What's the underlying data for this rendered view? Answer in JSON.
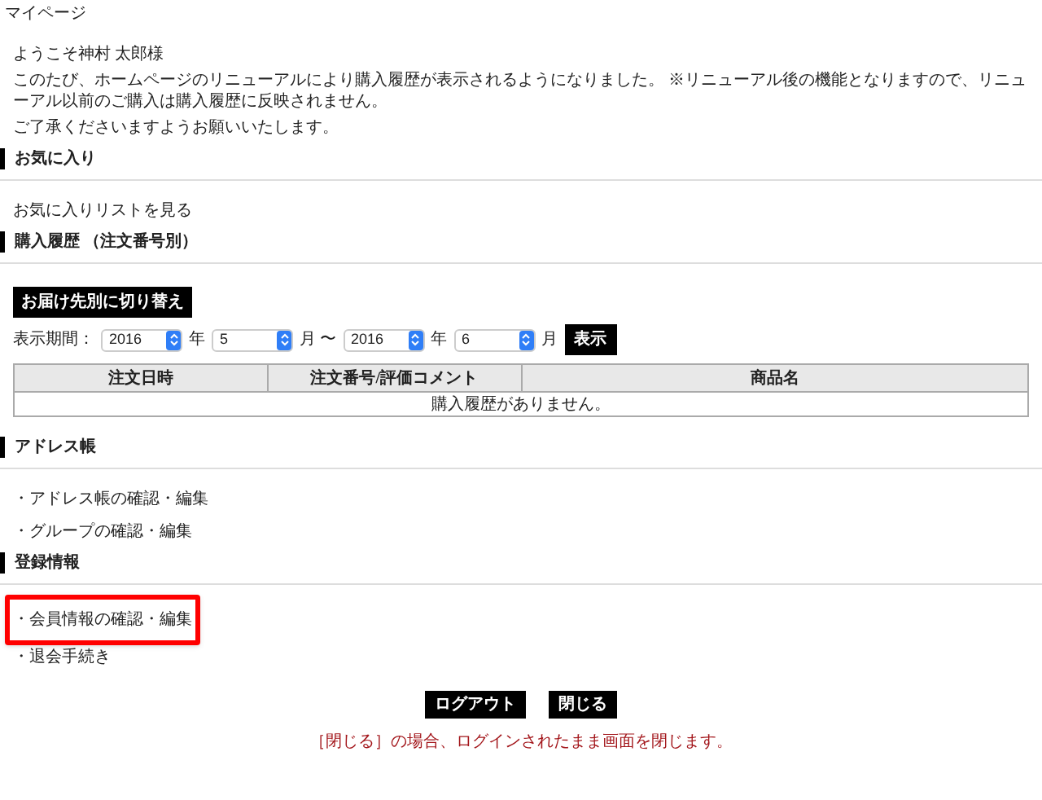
{
  "page_title": "マイページ",
  "greeting": "ようこそ神村 太郎様",
  "notice": [
    "このたび、ホームページのリニューアルにより購入履歴が表示されるようになりました。 ※リニューアル後の機能となりますので、リニューアル以前のご購入は購入履歴に反映されません。",
    "ご了承くださいますようお願いいたします。"
  ],
  "sections": [
    {
      "kind": "links",
      "heading": "お気に入り",
      "links": [
        {
          "label": "お気に入りリストを見る",
          "highlighted": false
        }
      ]
    },
    {
      "kind": "history",
      "heading": "購入履歴 （注文番号別）",
      "switch_button": "お届け先別に切り替え",
      "period": [
        {
          "kind": "label",
          "text": "表示期間："
        },
        {
          "kind": "select",
          "value": "2016"
        },
        {
          "kind": "unit",
          "text": "年"
        },
        {
          "kind": "select",
          "value": "5"
        },
        {
          "kind": "unit",
          "text": "月 〜"
        },
        {
          "kind": "select",
          "value": "2016"
        },
        {
          "kind": "unit",
          "text": "年"
        },
        {
          "kind": "select",
          "value": "6"
        },
        {
          "kind": "unit",
          "text": "月"
        },
        {
          "kind": "button",
          "text": "表示"
        }
      ],
      "table": {
        "columns": [
          "注文日時",
          "注文番号/評価コメント",
          "商品名"
        ],
        "empty_message": "購入履歴がありません。"
      }
    },
    {
      "kind": "links",
      "heading": "アドレス帳",
      "links": [
        {
          "label": "・アドレス帳の確認・編集",
          "highlighted": false
        },
        {
          "label": "・グループの確認・編集",
          "highlighted": false
        }
      ]
    },
    {
      "kind": "links",
      "heading": "登録情報",
      "links": [
        {
          "label": "・会員情報の確認・編集",
          "highlighted": true
        },
        {
          "label": "・退会手続き",
          "highlighted": false
        }
      ]
    }
  ],
  "footer_buttons": [
    "ログアウト",
    "閉じる"
  ],
  "footer_note": "［閉じる］の場合、ログインされたまま画面を閉じます。"
}
